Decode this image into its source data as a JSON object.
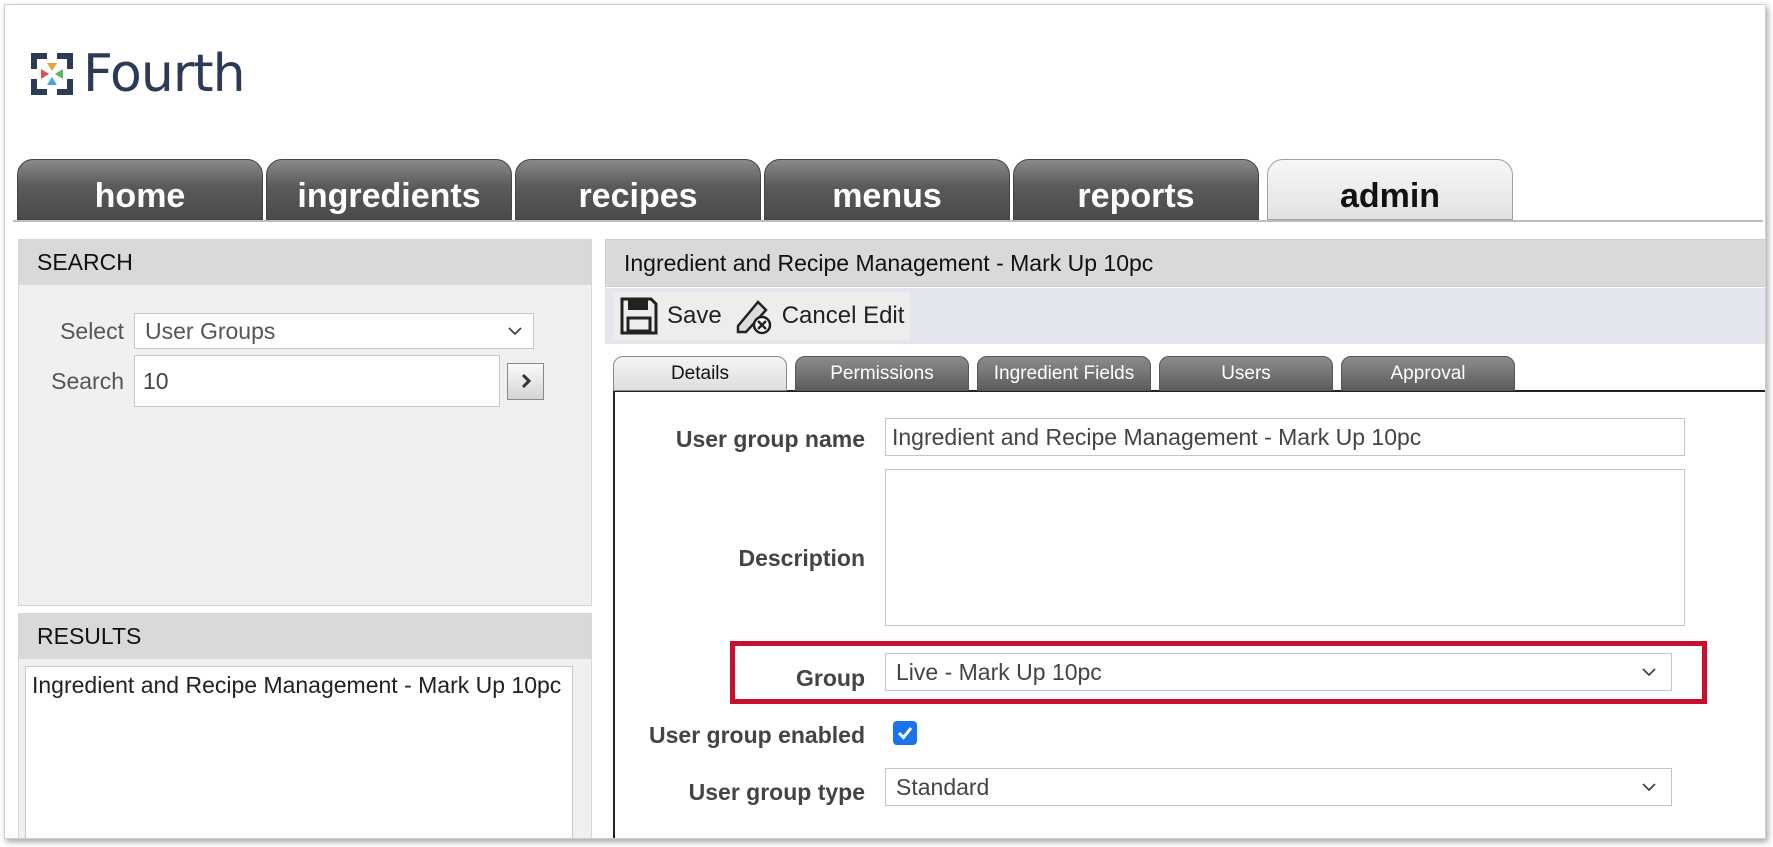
{
  "brand": {
    "name": "Fourth"
  },
  "nav": {
    "tabs": [
      {
        "label": "home"
      },
      {
        "label": "ingredients"
      },
      {
        "label": "recipes"
      },
      {
        "label": "menus"
      },
      {
        "label": "reports"
      },
      {
        "label": "admin",
        "active": true
      }
    ]
  },
  "search": {
    "title": "SEARCH",
    "select_label": "Select",
    "select_value": "User Groups",
    "search_label": "Search",
    "search_value": "10"
  },
  "results": {
    "title": "RESULTS",
    "items": [
      "Ingredient and Recipe Management - Mark Up 10pc"
    ]
  },
  "detail": {
    "title": "Ingredient and Recipe Management - Mark Up 10pc",
    "toolbar": {
      "save_label": "Save",
      "cancel_label": "Cancel Edit"
    },
    "tabs": [
      {
        "label": "Details",
        "active": true
      },
      {
        "label": "Permissions"
      },
      {
        "label": "Ingredient Fields"
      },
      {
        "label": "Users"
      },
      {
        "label": "Approval"
      }
    ],
    "form": {
      "name_label": "User group name",
      "name_value": "Ingredient and Recipe Management - Mark Up 10pc",
      "description_label": "Description",
      "description_value": "",
      "group_label": "Group",
      "group_value": "Live - Mark Up 10pc",
      "enabled_label": "User group enabled",
      "enabled": true,
      "type_label": "User group type",
      "type_value": "Standard"
    }
  },
  "colors": {
    "highlight": "#c8102e",
    "checkbox": "#1a73e8",
    "tab_active": "#e2e2e2",
    "tab_inactive": "#5a5a5a"
  }
}
